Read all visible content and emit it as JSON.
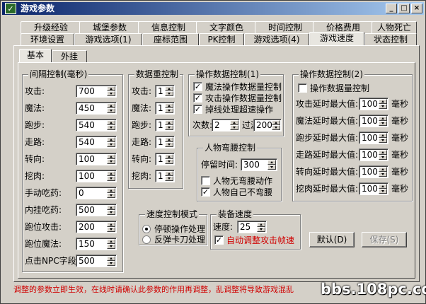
{
  "window": {
    "title": "游戏参数",
    "min_symbol": "_",
    "max_symbol": "□",
    "close_symbol": "×"
  },
  "tabs_row1": [
    "升级经验",
    "城堡参数",
    "信息控制",
    "文字颜色",
    "时间控制",
    "价格费用",
    "人物死亡"
  ],
  "tabs_row2": [
    "环境设置",
    "游戏选项(1)",
    "座标范围",
    "PK控制",
    "游戏选项(4)",
    "游戏速度",
    "状态控制"
  ],
  "subtabs": [
    "基本",
    "外挂"
  ],
  "interval_control": {
    "title": "间隔控制(毫秒)",
    "rows": [
      {
        "label": "攻击:",
        "value": "700"
      },
      {
        "label": "魔法:",
        "value": "450"
      },
      {
        "label": "跑步:",
        "value": "540"
      },
      {
        "label": "走路:",
        "value": "540"
      },
      {
        "label": "转向:",
        "value": "100"
      },
      {
        "label": "挖肉:",
        "value": "100"
      },
      {
        "label": "手动吃药:",
        "value": "0"
      },
      {
        "label": "内挂吃药:",
        "value": "500"
      },
      {
        "label": "跑位攻击:",
        "value": "200"
      },
      {
        "label": "跑位魔法:",
        "value": "150"
      },
      {
        "label": "点击NPC字段:",
        "value": "500"
      }
    ]
  },
  "data_control": {
    "title": "数据重控制",
    "rows": [
      {
        "label": "攻击:",
        "value": "1"
      },
      {
        "label": "魔法:",
        "value": "1"
      },
      {
        "label": "跑步:",
        "value": "1"
      },
      {
        "label": "走路:",
        "value": "1"
      },
      {
        "label": "转向:",
        "value": "1"
      },
      {
        "label": "挖肉:",
        "value": "1"
      }
    ]
  },
  "op_control1": {
    "title": "操作数据控制(1)",
    "magic_check": {
      "label": "魔法操作数据量控制",
      "checked": true
    },
    "attack_check": {
      "label": "攻击操作数据量控制",
      "checked": true
    },
    "disconnect_check": {
      "label": "掉线处理超速操作",
      "checked": true
    },
    "count_label": "次数:",
    "count_value": "2",
    "filter_label": "过滤:",
    "filter_value": "200"
  },
  "bow_control": {
    "title": "人物弯腰控制",
    "stop_label": "停留时间:",
    "stop_value": "300",
    "no_bow_check": {
      "label": "人物无弯腰动作",
      "checked": false
    },
    "self_no_bow_check": {
      "label": "人物自己不弯腰",
      "checked": true
    }
  },
  "op_control2": {
    "title": "操作数据控制(2)",
    "enable_check": {
      "label": "操作数据量控制",
      "checked": false
    },
    "unit": "毫秒",
    "rows": [
      {
        "label": "攻击延时最大值:",
        "value": "100"
      },
      {
        "label": "魔法延时最大值:",
        "value": "100"
      },
      {
        "label": "跑步延时最大值:",
        "value": "100"
      },
      {
        "label": "走路延时最大值:",
        "value": "100"
      },
      {
        "label": "转向延时最大值:",
        "value": "100"
      },
      {
        "label": "挖肉延时最大值:",
        "value": "100"
      }
    ]
  },
  "speed_mode": {
    "title": "速度控制模式",
    "options": [
      {
        "label": "停顿操作处理",
        "selected": true
      },
      {
        "label": "反弹卡刀处理",
        "selected": false
      }
    ]
  },
  "equip_speed": {
    "title": "装备速度",
    "speed_label": "速度:",
    "speed_value": "25",
    "auto_check": {
      "label": "自动调整攻击帧速",
      "checked": true
    }
  },
  "buttons": {
    "default": "默认(D)",
    "save": "保存(S)"
  },
  "status_text": "调整的参数立即生效，在线时请确认此参数的作用再调整，乱调整将导致游戏混乱",
  "watermark": "bbs.108pc.com",
  "colors": {
    "title_start": "#0a246a",
    "title_end": "#a6caf0",
    "face": "#d4d0c8",
    "warning": "#d00000"
  }
}
